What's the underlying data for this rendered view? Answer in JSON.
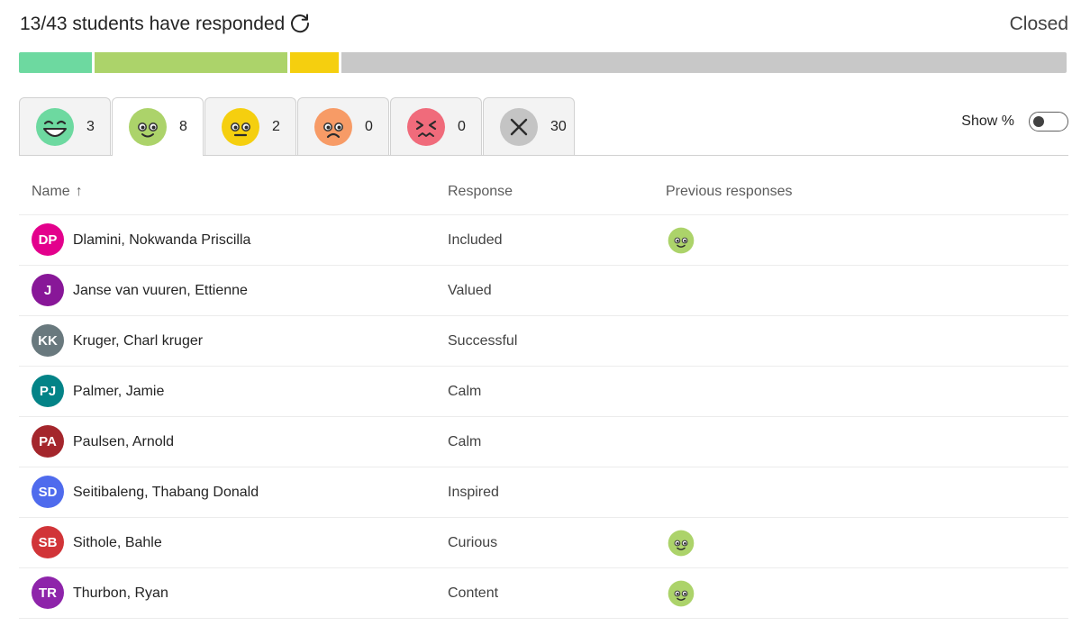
{
  "header": {
    "title": "13/43 students have responded",
    "status": "Closed"
  },
  "progress": [
    {
      "fraction": 0.0698,
      "color": "#6dd9a0"
    },
    {
      "fraction": 0.186,
      "color": "#acd36a"
    },
    {
      "fraction": 0.0465,
      "color": "#f5cf0f"
    },
    {
      "fraction": 0.6977,
      "color": "#c8c8c8"
    }
  ],
  "tabs": [
    {
      "icon": "big-smile-face-icon",
      "count": "3",
      "color": "#6dd9a0"
    },
    {
      "icon": "happy-face-icon",
      "count": "8",
      "color": "#acd36a",
      "selected": true
    },
    {
      "icon": "neutral-face-icon",
      "count": "2",
      "color": "#f5cf0f"
    },
    {
      "icon": "sad-face-icon",
      "count": "0",
      "color": "#f79b66"
    },
    {
      "icon": "stressed-face-icon",
      "count": "0",
      "color": "#f06b7b"
    },
    {
      "icon": "no-response-icon",
      "count": "30",
      "color": "#c4c4c4"
    }
  ],
  "show_percent": {
    "label": "Show %",
    "on": false
  },
  "table": {
    "columns": {
      "name": "Name",
      "sort_arrow": "↑",
      "response": "Response",
      "previous": "Previous responses"
    },
    "rows": [
      {
        "initials": "DP",
        "avatar_color": "#e3008c",
        "name": "Dlamini, Nokwanda Priscilla",
        "response": "Included",
        "previous": "happy-face-icon"
      },
      {
        "initials": "J",
        "avatar_color": "#881798",
        "name": "Janse van vuuren, Ettienne",
        "response": "Valued",
        "previous": ""
      },
      {
        "initials": "KK",
        "avatar_color": "#69797e",
        "name": "Kruger, Charl kruger",
        "response": "Successful",
        "previous": ""
      },
      {
        "initials": "PJ",
        "avatar_color": "#038387",
        "name": "Palmer, Jamie",
        "response": "Calm",
        "previous": ""
      },
      {
        "initials": "PA",
        "avatar_color": "#a4262c",
        "name": "Paulsen, Arnold",
        "response": "Calm",
        "previous": ""
      },
      {
        "initials": "SD",
        "avatar_color": "#4f6bed",
        "name": "Seitibaleng, Thabang Donald",
        "response": "Inspired",
        "previous": ""
      },
      {
        "initials": "SB",
        "avatar_color": "#d13438",
        "name": "Sithole, Bahle",
        "response": "Curious",
        "previous": "happy-face-icon"
      },
      {
        "initials": "TR",
        "avatar_color": "#8e24aa",
        "name": "Thurbon, Ryan",
        "response": "Content",
        "previous": "happy-face-icon"
      }
    ]
  }
}
